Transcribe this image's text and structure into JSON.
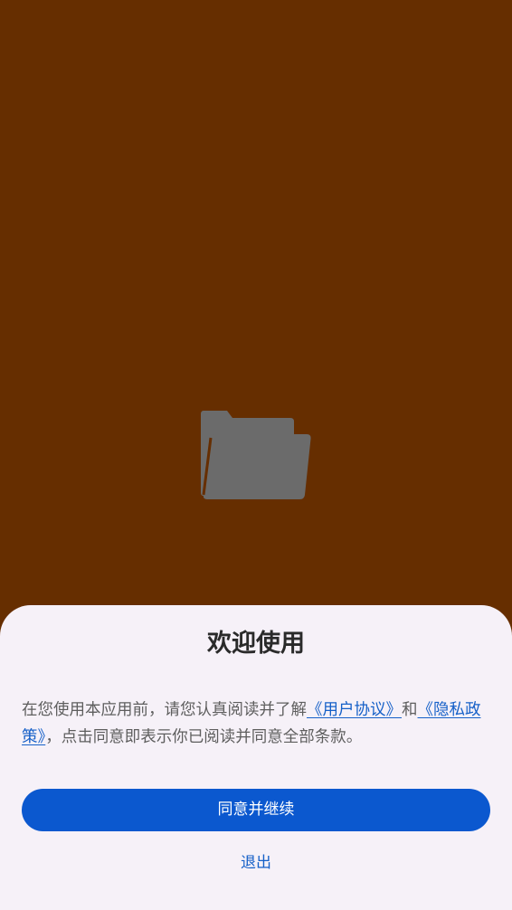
{
  "dialog": {
    "title": "欢迎使用",
    "notice": {
      "text_before": "在您使用本应用前，请您认真阅读并了解",
      "user_agreement_link": "《用户协议》",
      "text_and": "和",
      "privacy_policy_link": "《隐私政策》",
      "text_after": "，点击同意即表示你已阅读并同意全部条款。"
    },
    "agree_button_label": "同意并继续",
    "exit_button_label": "退出"
  },
  "colors": {
    "splash_background": "#662e00",
    "sheet_background": "#f6f1f8",
    "primary": "#0b58cf",
    "link": "#1560c8",
    "folder_icon": "#6b6b6b"
  },
  "icons": {
    "splash": "folder-icon"
  }
}
